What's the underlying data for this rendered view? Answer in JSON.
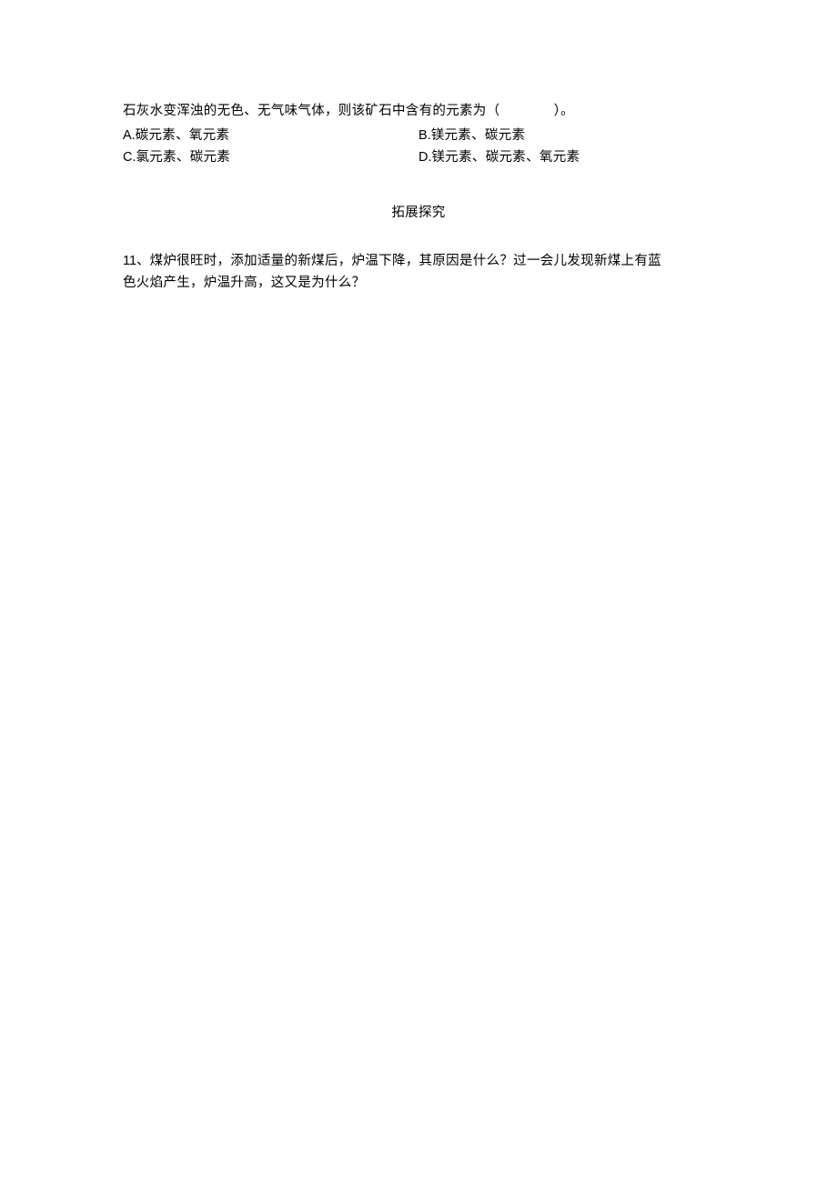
{
  "q10": {
    "stem": "石灰水变浑浊的无色、无气味气体，则该矿石中含有的元素为（　　　　）。",
    "options": {
      "a_label": "A.",
      "a_text": "碳元素、氧元素",
      "b_label": "B.",
      "b_text": "镁元素、碳元素",
      "c_label": "C.",
      "c_text": "氯元素、碳元素",
      "d_label": "D.",
      "d_text": "镁元素、碳元素、氧元素"
    }
  },
  "section": {
    "title": "拓展探究"
  },
  "q11": {
    "number": "11、",
    "line1": "煤炉很旺时，添加适量的新煤后，炉温下降，其原因是什么？过一会儿发现新煤上有蓝",
    "line2": "色火焰产生，炉温升高，这又是为什么？"
  }
}
